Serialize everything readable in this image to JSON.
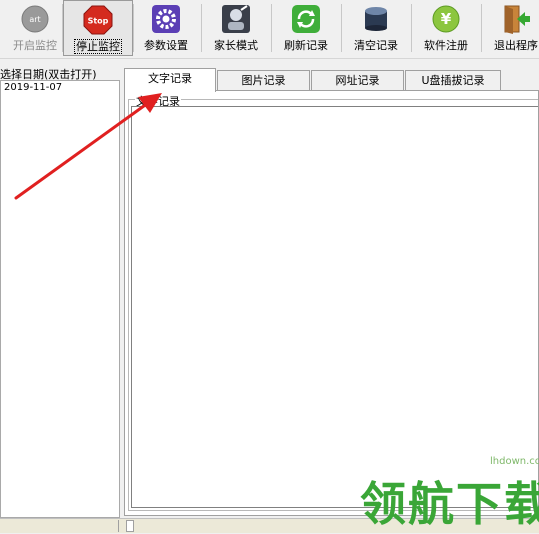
{
  "toolbar": {
    "buttons": [
      {
        "label": "开启监控",
        "icon": "start-icon"
      },
      {
        "label": "停止监控",
        "icon": "stop-sign-icon"
      },
      {
        "label": "参数设置",
        "icon": "gear-icon"
      },
      {
        "label": "家长模式",
        "icon": "parent-mode-icon"
      },
      {
        "label": "刷新记录",
        "icon": "refresh-icon"
      },
      {
        "label": "清空记录",
        "icon": "database-clear-icon"
      },
      {
        "label": "软件注册",
        "icon": "yen-coin-icon"
      },
      {
        "label": "退出程序",
        "icon": "exit-door-icon"
      }
    ],
    "start_icon_text": "art",
    "stop_icon_text": "Stop",
    "yen_icon_text": "¥"
  },
  "date_panel": {
    "title": "选择日期(双击打开)",
    "dates": [
      "2019-11-07"
    ]
  },
  "tabs": [
    {
      "label": "文字记录"
    },
    {
      "label": "图片记录"
    },
    {
      "label": "网址记录"
    },
    {
      "label": "U盘插拔记录"
    }
  ],
  "content": {
    "group_label": "文字记录"
  },
  "watermark": {
    "url": "lhdown.com",
    "text": "领航下载"
  },
  "colors": {
    "arrow": "#e02020",
    "watermark_green": "#3aa637"
  }
}
